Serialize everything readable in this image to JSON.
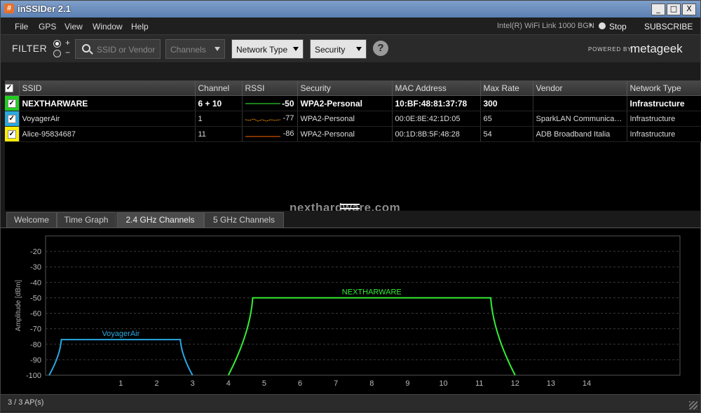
{
  "window": {
    "title": "inSSIDer 2.1",
    "icon": "#",
    "controls": [
      "_",
      "□",
      "X"
    ]
  },
  "menu": {
    "items": [
      "File",
      "GPS",
      "View",
      "Window",
      "Help"
    ]
  },
  "toolbar": {
    "adapter": "Intel(R) WiFi Link 1000 BGN",
    "stop_label": "Stop",
    "subscribe_label": "SUBSCRIBE"
  },
  "filter": {
    "label": "FILTER",
    "radio_plus": "+",
    "radio_minus": "−",
    "search_placeholder": "SSID or Vendor",
    "channels_label": "Channels",
    "network_type_label": "Network Type",
    "security_label": "Security",
    "help_glyph": "?"
  },
  "branding": {
    "powered_by": "POWERED BY",
    "logo": "metageek"
  },
  "table": {
    "columns": [
      "SSID",
      "Channel",
      "RSSI",
      "Security",
      "MAC Address",
      "Max Rate",
      "Vendor",
      "Network Type"
    ],
    "rows": [
      {
        "color": "#22cc22",
        "ssid": "NEXTHARWARE",
        "channel": "6 + 10",
        "rssi": "-50",
        "security": "WPA2-Personal",
        "mac": "10:BF:48:81:37:78",
        "max_rate": "300",
        "vendor": "",
        "network_type": "Infrastructure",
        "selected": true,
        "spark_color": "#33ff33"
      },
      {
        "color": "#2aa8e0",
        "ssid": "VoyagerAir",
        "channel": "1",
        "rssi": "-77",
        "security": "WPA2-Personal",
        "mac": "00:0E:8E:42:1D:05",
        "max_rate": "65",
        "vendor": "SparkLAN Communicatio...",
        "network_type": "Infrastructure",
        "selected": false,
        "spark_color": "#ff9900"
      },
      {
        "color": "#ffee00",
        "ssid": "Alice-95834687",
        "channel": "11",
        "rssi": "-86",
        "security": "WPA2-Personal",
        "mac": "00:1D:8B:5F:48:28",
        "max_rate": "54",
        "vendor": "ADB Broadband Italia",
        "network_type": "Infrastructure",
        "selected": false,
        "spark_color": "#ff6600"
      }
    ]
  },
  "watermark": "nexthardware.com",
  "tabs": [
    {
      "label": "Welcome",
      "active": false
    },
    {
      "label": "Time Graph",
      "active": false
    },
    {
      "label": "2.4 GHz Channels",
      "active": true
    },
    {
      "label": "5 GHz Channels",
      "active": false
    }
  ],
  "chart_data": {
    "type": "area",
    "ylabel": "Amplitude [dBm]",
    "ylim": [
      -100,
      -10
    ],
    "yticks": [
      -20,
      -30,
      -40,
      -50,
      -60,
      -70,
      -80,
      -90,
      -100
    ],
    "xticks": [
      1,
      2,
      3,
      4,
      5,
      6,
      7,
      8,
      9,
      10,
      11,
      12,
      13,
      14
    ],
    "xlim": [
      -1.1,
      16.6
    ],
    "grid": true,
    "series": [
      {
        "name": "VoyagerAir",
        "color": "#2aa8e0",
        "channel": 1,
        "start": -1,
        "end": 3,
        "amplitude": -77
      },
      {
        "name": "NEXTHARWARE",
        "color": "#33ee33",
        "channel": "6 + 10",
        "start": 4,
        "end": 12,
        "amplitude": -50
      }
    ]
  },
  "status": {
    "text": "3 / 3 AP(s)"
  }
}
